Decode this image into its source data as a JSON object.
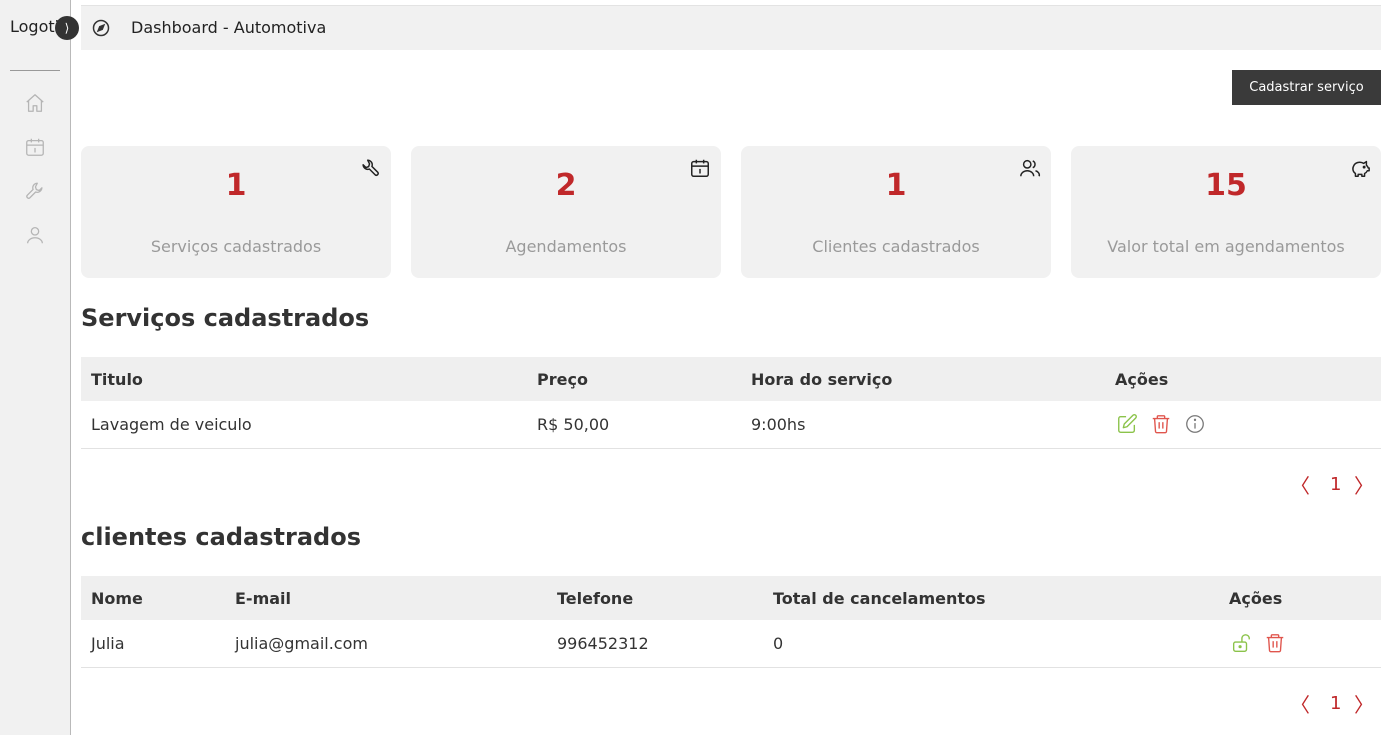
{
  "sidebar": {
    "logo": "Logotipo",
    "toggle_icon": "chevron-right-icon",
    "items": [
      {
        "name": "home",
        "icon": "home-icon"
      },
      {
        "name": "agenda",
        "icon": "calendar-icon"
      },
      {
        "name": "servicos",
        "icon": "wrench-icon"
      },
      {
        "name": "clientes",
        "icon": "user-icon"
      }
    ]
  },
  "header": {
    "icon": "compass-icon",
    "title": "Dashboard - Automotiva"
  },
  "actions": {
    "cadastrar_label": "Cadastrar serviço"
  },
  "cards": [
    {
      "value": "1",
      "label": "Serviços cadastrados",
      "icon": "wrench-icon"
    },
    {
      "value": "2",
      "label": "Agendamentos",
      "icon": "calendar-icon"
    },
    {
      "value": "1",
      "label": "Clientes cadastrados",
      "icon": "users-icon"
    },
    {
      "value": "15",
      "label": "Valor total em agendamentos",
      "icon": "piggy-bank-icon"
    }
  ],
  "servicos": {
    "title": "Serviços cadastrados",
    "headers": [
      "Titulo",
      "Preço",
      "Hora do serviço",
      "Ações"
    ],
    "rows": [
      {
        "titulo": "Lavagem de veiculo",
        "preco": "R$ 50,00",
        "hora": "9:00hs"
      }
    ],
    "pagination": {
      "prev": "〈",
      "page": "1",
      "next": "〉"
    }
  },
  "clientes": {
    "title": "clientes cadastrados",
    "headers": [
      "Nome",
      "E-mail",
      "Telefone",
      "Total de cancelamentos",
      "Ações"
    ],
    "rows": [
      {
        "nome": "Julia",
        "email": "julia@gmail.com",
        "telefone": "996452312",
        "cancelamentos": "0"
      }
    ],
    "pagination": {
      "prev": "〈",
      "page": "1",
      "next": "〉"
    }
  },
  "colors": {
    "accent": "#c0282a",
    "edit": "#8bc34a",
    "delete": "#e0554d",
    "dark": "#3a3a3a",
    "panel": "#f1f1f1"
  }
}
